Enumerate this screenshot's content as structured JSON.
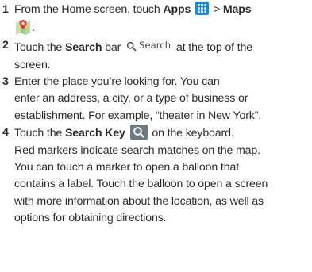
{
  "steps": [
    {
      "number": "1",
      "text_a": "From the Home screen, touch ",
      "apps_label": "Apps",
      "text_b": " > ",
      "maps_label": "Maps",
      "apps_icon": "apps-grid-icon",
      "maps_icon": "maps-pin-icon"
    },
    {
      "number": "2",
      "text_a": "Touch the ",
      "search_label": "Search",
      "text_b": " bar",
      "search_bar_text": "Search",
      "text_c_line1": " at the top of the",
      "text_c_line2": "screen.",
      "search_icon": "magnifier-icon"
    },
    {
      "number": "3",
      "lines": [
        "Enter the place you’re looking for. You can",
        "enter an address, a city, or a type of business or",
        "establishment. For example, “theater in New York”."
      ]
    },
    {
      "number": "4",
      "text_a": "Touch the ",
      "search_key_label": "Search Key",
      "text_b": " on the keyboard.",
      "search_key_icon": "search-key-icon",
      "lines": [
        "Red markers indicate search matches on the map.",
        "You can touch a marker to open a balloon that",
        "contains a label. Touch the balloon to open a screen",
        "with more information about the location, as well as",
        "options for obtaining directions."
      ]
    }
  ],
  "colors": {
    "text": "#2b2b2b",
    "apps_icon_bg": "#1e88d8",
    "search_key_bg": "#6d7a82"
  }
}
